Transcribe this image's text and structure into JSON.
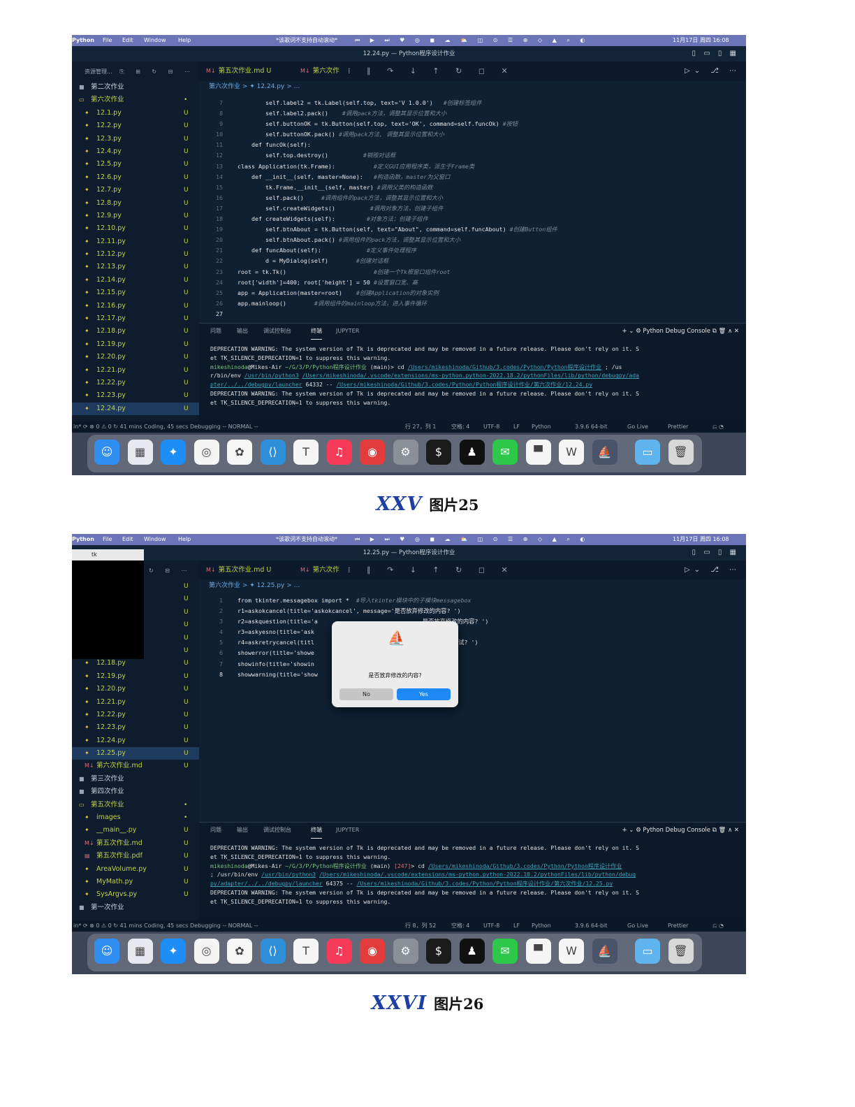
{
  "shots": [
    {
      "menubar": {
        "app": "Python",
        "items": [
          "File",
          "Edit",
          "Window",
          "Help"
        ],
        "lyric": "*该歌词不支持自动滚动*",
        "clock": "11月17日 周四  16:08"
      },
      "window_title": "12.24.py — Python程序设计作业",
      "sidebar_header": "资源管理...",
      "tree": [
        {
          "label": "第二次作业",
          "kind": "folder",
          "state": "",
          "indent": 0
        },
        {
          "label": "第六次作业",
          "kind": "open",
          "state": "•",
          "indent": 0
        },
        {
          "label": "12.1.py",
          "kind": "file",
          "state": "U",
          "indent": 1
        },
        {
          "label": "12.2.py",
          "kind": "file",
          "state": "U",
          "indent": 1
        },
        {
          "label": "12.3.py",
          "kind": "file",
          "state": "U",
          "indent": 1
        },
        {
          "label": "12.4.py",
          "kind": "file",
          "state": "U",
          "indent": 1
        },
        {
          "label": "12.5.py",
          "kind": "file",
          "state": "U",
          "indent": 1
        },
        {
          "label": "12.6.py",
          "kind": "file",
          "state": "U",
          "indent": 1
        },
        {
          "label": "12.7.py",
          "kind": "file",
          "state": "U",
          "indent": 1
        },
        {
          "label": "12.8.py",
          "kind": "file",
          "state": "U",
          "indent": 1
        },
        {
          "label": "12.9.py",
          "kind": "file",
          "state": "U",
          "indent": 1
        },
        {
          "label": "12.10.py",
          "kind": "file",
          "state": "U",
          "indent": 1
        },
        {
          "label": "12.11.py",
          "kind": "file",
          "state": "U",
          "indent": 1
        },
        {
          "label": "12.12.py",
          "kind": "file",
          "state": "U",
          "indent": 1
        },
        {
          "label": "12.13.py",
          "kind": "file",
          "state": "U",
          "indent": 1
        },
        {
          "label": "12.14.py",
          "kind": "file",
          "state": "U",
          "indent": 1
        },
        {
          "label": "12.15.py",
          "kind": "file",
          "state": "U",
          "indent": 1
        },
        {
          "label": "12.16.py",
          "kind": "file",
          "state": "U",
          "indent": 1
        },
        {
          "label": "12.17.py",
          "kind": "file",
          "state": "U",
          "indent": 1
        },
        {
          "label": "12.18.py",
          "kind": "file",
          "state": "U",
          "indent": 1
        },
        {
          "label": "12.19.py",
          "kind": "file",
          "state": "U",
          "indent": 1
        },
        {
          "label": "12.20.py",
          "kind": "file",
          "state": "U",
          "indent": 1
        },
        {
          "label": "12.21.py",
          "kind": "file",
          "state": "U",
          "indent": 1
        },
        {
          "label": "12.22.py",
          "kind": "file",
          "state": "U",
          "indent": 1
        },
        {
          "label": "12.23.py",
          "kind": "file",
          "state": "U",
          "indent": 1
        },
        {
          "label": "12.24.py",
          "kind": "file",
          "state": "U",
          "indent": 1,
          "selected": true
        }
      ],
      "tabs": [
        "第五次作业.md U",
        "第六次作"
      ],
      "breadcrumb": "第六次作业 > ✦ 12.24.py > ...",
      "code": [
        {
          "n": "7",
          "c": "        self.label2 = tk.Label(self.top, text='V 1.0.0')",
          "m": "   #创建标签组件"
        },
        {
          "n": "8",
          "c": "        self.label2.pack()",
          "m": "    #调用pack方法，调整其显示位置和大小"
        },
        {
          "n": "9",
          "c": "        self.buttonOK = tk.Button(self.top, text='OK', command=self.funcOk)",
          "m": " #按钮"
        },
        {
          "n": "10",
          "c": "        self.buttonOK.pack()",
          "m": " #调用pack方法, 调整其显示位置和大小"
        },
        {
          "n": "11",
          "c": "    def funcOk(self):",
          "m": ""
        },
        {
          "n": "12",
          "c": "        self.top.destroy()",
          "m": "          #销毁对话框"
        },
        {
          "n": "13",
          "c": "class Application(tk.Frame):",
          "m": "           #定义GUI应用程序类，派生于Frame类"
        },
        {
          "n": "14",
          "c": "    def __init__(self, master=None):",
          "m": "   #构造函数，master为父窗口"
        },
        {
          "n": "15",
          "c": "        tk.Frame.__init__(self, master)",
          "m": " #调用父类的构造函数"
        },
        {
          "n": "16",
          "c": "        self.pack()",
          "m": "     #调用组件的pack方法，调整其显示位置和大小"
        },
        {
          "n": "17",
          "c": "        self.createWidgets()",
          "m": "          #调用对象方法，创建子组件"
        },
        {
          "n": "18",
          "c": "    def createWidgets(self):",
          "m": "         #对象方法：创建子组件"
        },
        {
          "n": "19",
          "c": "        self.btnAbout = tk.Button(self, text=\"About\", command=self.funcAbout)",
          "m": " #创建Button组件"
        },
        {
          "n": "20",
          "c": "        self.btnAbout.pack()",
          "m": " #调用组件的pack方法，调整其显示位置和大小"
        },
        {
          "n": "21",
          "c": "    def funcAbout(self):",
          "m": "             #定义事件处理程序"
        },
        {
          "n": "22",
          "c": "        d = MyDialog(self)",
          "m": "        #创建对话框"
        },
        {
          "n": "23",
          "c": "root = tk.Tk()",
          "m": "                         #创建一个Tk根窗口组件root"
        },
        {
          "n": "24",
          "c": "root['width']=400; root['height'] = 50",
          "m": " #设置窗口宽、高"
        },
        {
          "n": "25",
          "c": "app = Application(master=root)",
          "m": "    #创建Application的对象实例"
        },
        {
          "n": "26",
          "c": "app.mainloop()",
          "m": "        #调用组件的mainloop方法，进入事件循环"
        },
        {
          "n": "27",
          "c": "",
          "m": "",
          "cur": true
        }
      ],
      "panel_tabs": [
        "问题",
        "输出",
        "调试控制台",
        "终端",
        "JUPYTER"
      ],
      "panel_right": "+ ⌄  ⚙ Python Debug Console  ⧉  🗑  ∧  ✕",
      "terminal": [
        [
          [
            "t",
            "DEPRECATION WARNING: The system version of Tk is deprecated and may be removed in a future release. Please don't rely on it. S"
          ]
        ],
        [
          [
            "t",
            "et TK_SILENCE_DEPRECATION=1 to suppress this warning."
          ]
        ],
        [
          [
            "p",
            "mikeshinoda"
          ],
          [
            "t",
            "@Mikes-Air "
          ],
          [
            "p",
            "~/G/3/P/Python程序设计作业"
          ],
          [
            "t",
            " (main)>  cd "
          ],
          [
            "u",
            "/Users/mikeshinoda/Github/3.codes/Python/Python程序设计作业"
          ],
          [
            "t",
            " ; /us"
          ]
        ],
        [
          [
            "t",
            "r/bin/env "
          ],
          [
            "u",
            "/usr/bin/python3"
          ],
          [
            "t",
            " "
          ],
          [
            "u",
            "/Users/mikeshinoda/.vscode/extensions/ms-python.python-2022.18.2/pythonFiles/lib/python/debugpy/ada"
          ]
        ],
        [
          [
            "u",
            "pter/../../debugpy/launcher"
          ],
          [
            "t",
            " 64332 -- "
          ],
          [
            "u",
            "/Users/mikeshinoda/Github/3.codes/Python/Python程序设计作业/第六次作业/12.24.py"
          ]
        ],
        [
          [
            "t",
            "DEPRECATION WARNING: The system version of Tk is deprecated and may be removed in a future release. Please don't rely on it. S"
          ]
        ],
        [
          [
            "t",
            "et TK_SILENCE_DEPRECATION=1 to suppress this warning."
          ]
        ]
      ],
      "status": {
        "left": "in*   ⟳   ⊗ 0 ⚠ 0    ↻ 41 mins Coding, 45 secs Debugging    -- NORMAL --",
        "pos": "行 27，列 1",
        "spaces": "空格: 4",
        "enc": "UTF-8",
        "eol": "LF",
        "lang": "Python",
        "ver": "3.9.6 64-bit",
        "golive": "Go Live",
        "prettier": "Prettier"
      }
    },
    {
      "menubar": {
        "app": "Python",
        "items": [
          "File",
          "Edit",
          "Window",
          "Help"
        ],
        "lyric": "*该歌词不支持自动滚动*",
        "clock": "11月17日 周四  16:08"
      },
      "window_title": "12.25.py — Python程序设计作业",
      "tk_title": "tk",
      "tree": [
        {
          "label": "",
          "kind": "file",
          "state": "U",
          "indent": 1,
          "hidden": true
        },
        {
          "label": "",
          "kind": "file",
          "state": "U",
          "indent": 1,
          "hidden": true
        },
        {
          "label": "",
          "kind": "file",
          "state": "U",
          "indent": 1,
          "hidden": true
        },
        {
          "label": "",
          "kind": "file",
          "state": "U",
          "indent": 1,
          "hidden": true
        },
        {
          "label": "",
          "kind": "file",
          "state": "U",
          "indent": 1,
          "hidden": true
        },
        {
          "label": "",
          "kind": "file",
          "state": "U",
          "indent": 1,
          "hidden": true
        },
        {
          "label": "12.18.py",
          "kind": "file",
          "state": "U",
          "indent": 1
        },
        {
          "label": "12.19.py",
          "kind": "file",
          "state": "U",
          "indent": 1
        },
        {
          "label": "12.20.py",
          "kind": "file",
          "state": "U",
          "indent": 1
        },
        {
          "label": "12.21.py",
          "kind": "file",
          "state": "U",
          "indent": 1
        },
        {
          "label": "12.22.py",
          "kind": "file",
          "state": "U",
          "indent": 1
        },
        {
          "label": "12.23.py",
          "kind": "file",
          "state": "U",
          "indent": 1
        },
        {
          "label": "12.24.py",
          "kind": "file",
          "state": "U",
          "indent": 1
        },
        {
          "label": "12.25.py",
          "kind": "file",
          "state": "U",
          "indent": 1,
          "selected": true
        },
        {
          "label": "第六次作业.md",
          "kind": "file",
          "state": "U",
          "indent": 1,
          "md": true
        },
        {
          "label": "第三次作业",
          "kind": "folder",
          "state": "",
          "indent": 0
        },
        {
          "label": "第四次作业",
          "kind": "folder",
          "state": "",
          "indent": 0
        },
        {
          "label": "第五次作业",
          "kind": "open",
          "state": "•",
          "indent": 0
        },
        {
          "label": "images",
          "kind": "file",
          "state": "•",
          "indent": 1
        },
        {
          "label": "__main__.py",
          "kind": "file",
          "state": "U",
          "indent": 1
        },
        {
          "label": "第五次作业.md",
          "kind": "file",
          "state": "U",
          "indent": 1,
          "md": true
        },
        {
          "label": "第五次作业.pdf",
          "kind": "file",
          "state": "U",
          "indent": 1,
          "pdf": true
        },
        {
          "label": "AreaVolume.py",
          "kind": "file",
          "state": "U",
          "indent": 1
        },
        {
          "label": "MyMath.py",
          "kind": "file",
          "state": "U",
          "indent": 1
        },
        {
          "label": "SysArgvs.py",
          "kind": "file",
          "state": "U",
          "indent": 1
        },
        {
          "label": "第一次作业",
          "kind": "folder",
          "state": "",
          "indent": 0
        }
      ],
      "tabs": [
        "第五次作业.md U",
        "第六次作"
      ],
      "breadcrumb": "第六次作业 > ✦ 12.25.py > ...",
      "code": [
        {
          "n": "1",
          "c": "from tkinter.messagebox import *",
          "m": "  #导入tkinter模块中的子模块messagebox"
        },
        {
          "n": "2",
          "c": "r1=askokcancel(title='askokcancel', message='是否放弃修改的内容? ')",
          "m": ""
        },
        {
          "n": "3",
          "c": "r2=askquestion(title='a                              是否放弃修改的内容? ')",
          "m": ""
        },
        {
          "n": "4",
          "c": "r3=askyesno(title='ask                               容? ')",
          "m": ""
        },
        {
          "n": "5",
          "c": "r4=askretrycancel(titl                               统忙, 是否重试? ')",
          "m": ""
        },
        {
          "n": "6",
          "c": "showerror(title='showe",
          "m": ""
        },
        {
          "n": "7",
          "c": "showinfo(title='showin",
          "m": ""
        },
        {
          "n": "8",
          "c": "showwarning(title='show                              ')",
          "m": "",
          "cur": true
        }
      ],
      "dialog": {
        "message": "是否放弃修改的内容?",
        "no": "No",
        "yes": "Yes"
      },
      "panel_tabs": [
        "问题",
        "输出",
        "调试控制台",
        "终端",
        "JUPYTER"
      ],
      "panel_right": "+ ⌄  ⚙ Python Debug Console  ⧉  🗑  ∧  ✕",
      "terminal": [
        [
          [
            "t",
            "DEPRECATION WARNING: The system version of Tk is deprecated and may be removed in a future release. Please don't rely on it. S"
          ]
        ],
        [
          [
            "t",
            "et TK_SILENCE_DEPRECATION=1 to suppress this warning."
          ]
        ],
        [
          [
            "p",
            "mikeshinoda"
          ],
          [
            "t",
            "@Mikes-Air "
          ],
          [
            "p",
            "~/G/3/P/Python程序设计作业"
          ],
          [
            "t",
            " (main) "
          ],
          [
            "r",
            "[247]"
          ],
          [
            "t",
            ">  cd "
          ],
          [
            "u",
            "/Users/mikeshinoda/Github/3.codes/Python/Python程序设计作业"
          ]
        ],
        [
          [
            "t",
            " ; /usr/bin/env "
          ],
          [
            "u",
            "/usr/bin/python3"
          ],
          [
            "t",
            " "
          ],
          [
            "u",
            "/Users/mikeshinoda/.vscode/extensions/ms-python.python-2022.18.2/pythonFiles/lib/python/debug"
          ]
        ],
        [
          [
            "u",
            "py/adapter/../../debugpy/launcher"
          ],
          [
            "t",
            " 64375 -- "
          ],
          [
            "u",
            "/Users/mikeshinoda/Github/3.codes/Python/Python程序设计作业/第六次作业/12.25.py"
          ]
        ],
        [
          [
            "t",
            "DEPRECATION WARNING: The system version of Tk is deprecated and may be removed in a future release. Please don't rely on it. S"
          ]
        ],
        [
          [
            "t",
            "et TK_SILENCE_DEPRECATION=1 to suppress this warning."
          ]
        ]
      ],
      "status": {
        "left": "in*   ⟳   ⊗ 0 ⚠ 0    ↻ 41 mins Coding, 45 secs Debugging    -- NORMAL --",
        "pos": "行 8，列 52",
        "spaces": "空格: 4",
        "enc": "UTF-8",
        "eol": "LF",
        "lang": "Python",
        "ver": "3.9.6 64-bit",
        "golive": "Go Live",
        "prettier": "Prettier"
      }
    }
  ],
  "captions": [
    {
      "num": "XXV",
      "text": "图片25"
    },
    {
      "num": "XXVI",
      "text": "图片26"
    }
  ],
  "dock": [
    {
      "name": "finder-icon",
      "glyph": "☺",
      "color": "#2f8ef0"
    },
    {
      "name": "launchpad-icon",
      "glyph": "▦",
      "color": "#e8e8f0"
    },
    {
      "name": "safari-icon",
      "glyph": "✦",
      "color": "#1d8ef5"
    },
    {
      "name": "chrome-icon",
      "glyph": "◎",
      "color": "#f4f4f4"
    },
    {
      "name": "photos-icon",
      "glyph": "✿",
      "color": "#f6f6f6"
    },
    {
      "name": "vscode-icon",
      "glyph": "⟨⟩",
      "color": "#2e8ed8"
    },
    {
      "name": "typora-icon",
      "glyph": "T",
      "color": "#f5f5f5"
    },
    {
      "name": "music-icon",
      "glyph": "♫",
      "color": "#f53b57"
    },
    {
      "name": "netease-music-icon",
      "glyph": "◉",
      "color": "#e33c3c"
    },
    {
      "name": "system-settings-icon",
      "glyph": "⚙",
      "color": "#8a8f98"
    },
    {
      "name": "terminal-icon",
      "glyph": "$",
      "color": "#1b1b1b"
    },
    {
      "name": "qq-icon",
      "glyph": "♟",
      "color": "#111111"
    },
    {
      "name": "wechat-icon",
      "glyph": "✉",
      "color": "#2dc74a"
    },
    {
      "name": "lark-icon",
      "glyph": "▀",
      "color": "#f5f5f5"
    },
    {
      "name": "wps-icon",
      "glyph": "W",
      "color": "#f5f5f5"
    },
    {
      "name": "python-launcher-icon",
      "glyph": "⛵",
      "color": "#49546a"
    },
    {
      "name": "folder-icon",
      "glyph": "▭",
      "color": "#5fb3ee"
    },
    {
      "name": "trash-icon",
      "glyph": "🗑",
      "color": "#d7d7d7"
    }
  ]
}
